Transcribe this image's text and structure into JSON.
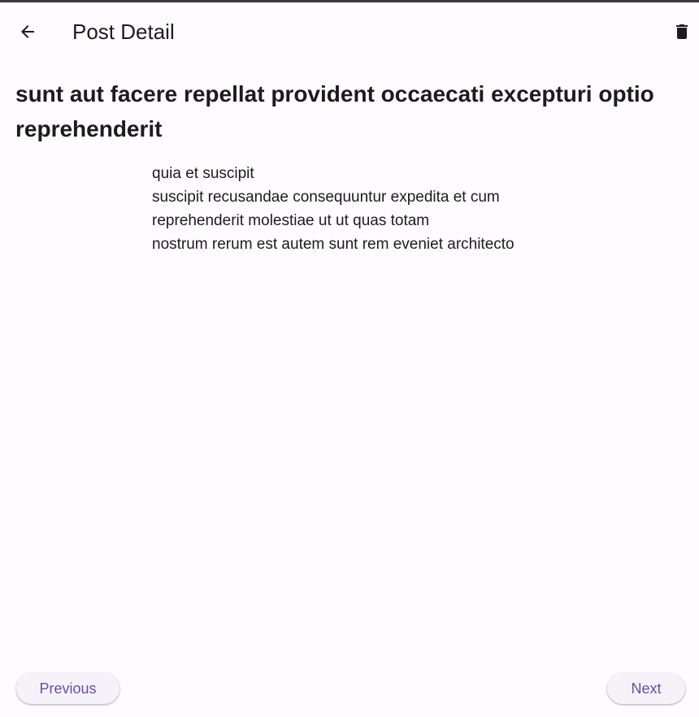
{
  "app_bar": {
    "title": "Post Detail",
    "back_icon": "arrow-back-icon",
    "delete_icon": "trash-icon"
  },
  "post": {
    "title": "sunt aut facere repellat provident occaecati excepturi optio reprehenderit",
    "body_lines": [
      "quia et suscipit",
      "suscipit recusandae consequuntur expedita et cum",
      "reprehenderit molestiae ut ut quas totam",
      "nostrum rerum est autem sunt rem eveniet architecto"
    ]
  },
  "pagination": {
    "previous_label": "Previous",
    "next_label": "Next"
  },
  "colors": {
    "background": "#fffbfe",
    "accent": "#6750a4",
    "button_surface": "#f7f2fa",
    "text": "#1c1b1f"
  }
}
